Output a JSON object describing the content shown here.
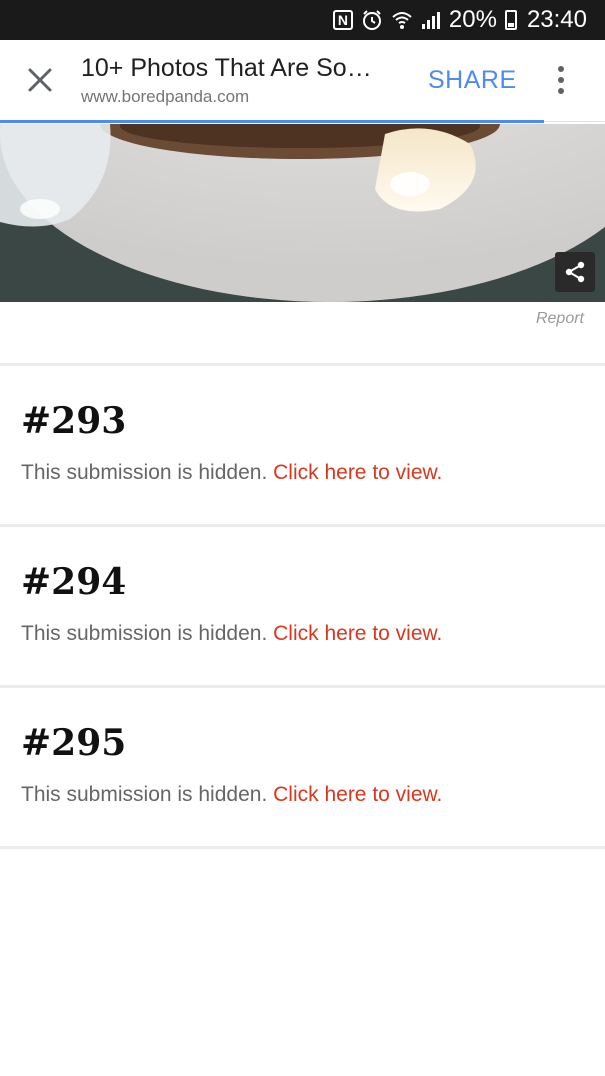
{
  "status_bar": {
    "battery": "20%",
    "time": "23:40"
  },
  "toolbar": {
    "title": "10+ Photos That Are So…",
    "url": "www.boredpanda.com",
    "share_label": "SHARE",
    "accent": "#4c8bf5"
  },
  "photo": {
    "report_label": "Report"
  },
  "submissions": [
    {
      "number": "#293",
      "text": "This submission is hidden.",
      "link": "Click here to view."
    },
    {
      "number": "#294",
      "text": "This submission is hidden.",
      "link": "Click here to view."
    },
    {
      "number": "#295",
      "text": "This submission is hidden.",
      "link": "Click here to view."
    }
  ],
  "colors": {
    "link": "#d9381e",
    "status_bar_bg": "#1a1a1a"
  },
  "icons": {
    "close": "close-icon",
    "more": "more-vertical-icon",
    "share_overlay": "share-icon",
    "nfc": "nfc-icon",
    "alarm": "alarm-icon",
    "wifi": "wifi-icon",
    "signal": "signal-icon",
    "battery": "battery-icon"
  }
}
